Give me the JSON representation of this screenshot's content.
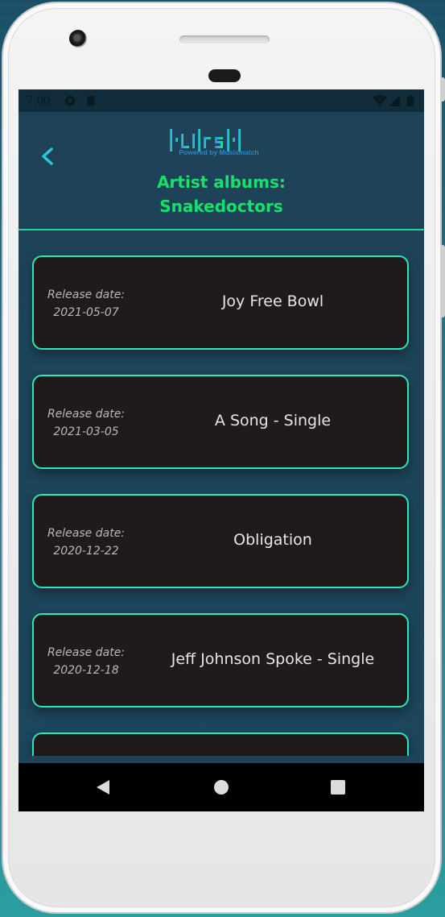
{
  "status_bar": {
    "time": "7:00"
  },
  "header": {
    "back_icon": "chevron-left-icon",
    "logo_text": "|·LI|rsI·|",
    "powered_by": "Powered by Musixmatch",
    "title_line1": "Artist albums:",
    "title_line2": "Snakedoctors"
  },
  "albums": [
    {
      "release_label": "Release date:",
      "release_date": "2021-05-07",
      "title": "Joy Free Bowl"
    },
    {
      "release_label": "Release date:",
      "release_date": "2021-03-05",
      "title": "A Song - Single"
    },
    {
      "release_label": "Release date:",
      "release_date": "2020-12-22",
      "title": "Obligation"
    },
    {
      "release_label": "Release date:",
      "release_date": "2020-12-18",
      "title": "Jeff Johnson Spoke - Single"
    }
  ],
  "nav": {
    "back": "triangle-back-icon",
    "home": "circle-home-icon",
    "recents": "square-recents-icon"
  },
  "colors": {
    "accent_green": "#18e06a",
    "card_border": "#2ee6b7",
    "card_bg": "#211a1b",
    "screen_bg": "#1e4358"
  }
}
